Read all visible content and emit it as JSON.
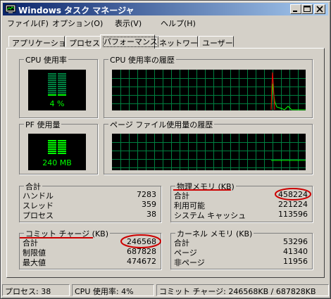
{
  "window": {
    "title": "Windows タスク マネージャ"
  },
  "menu": [
    "ファイル(F)",
    "オプション(O)",
    "表示(V)",
    "ヘルプ(H)"
  ],
  "tabs": [
    "アプリケーション",
    "プロセス",
    "パフォーマンス",
    "ネットワーク",
    "ユーザー"
  ],
  "active_tab": "パフォーマンス",
  "cpu_usage": {
    "label": "CPU 使用率",
    "value_text": "4 %",
    "level": 0.04
  },
  "cpu_history": {
    "label": "CPU 使用率の履歴"
  },
  "pf_usage": {
    "label": "PF 使用量",
    "value_text": "240 MB"
  },
  "pf_history": {
    "label": "ページ ファイル使用量の履歴"
  },
  "totals": {
    "label": "合計",
    "rows": [
      {
        "k": "ハンドル",
        "v": "7283"
      },
      {
        "k": "スレッド",
        "v": "359"
      },
      {
        "k": "プロセス",
        "v": "38"
      }
    ]
  },
  "physical_memory": {
    "label": "物理メモリ (KB)",
    "rows": [
      {
        "k": "合計",
        "v": "458224"
      },
      {
        "k": "利用可能",
        "v": "221224"
      },
      {
        "k": "システム キャッシュ",
        "v": "113596"
      }
    ]
  },
  "commit_charge": {
    "label": "コミット チャージ (KB)",
    "rows": [
      {
        "k": "合計",
        "v": "246568"
      },
      {
        "k": "制限値",
        "v": "687828"
      },
      {
        "k": "最大値",
        "v": "474672"
      }
    ]
  },
  "kernel_memory": {
    "label": "カーネル メモリ (KB)",
    "rows": [
      {
        "k": "合計",
        "v": "53296"
      },
      {
        "k": "ページ",
        "v": "41340"
      },
      {
        "k": "非ページ",
        "v": "11956"
      }
    ]
  },
  "status": {
    "processes": "プロセス: 38",
    "cpu": "CPU 使用率: 4%",
    "commit": "コミット チャージ: 246568KB / 687828KB"
  },
  "colors": {
    "graph_grid": "#008040",
    "graph_line": "#00ff00",
    "kernel_line": "#ff0000",
    "annotation": "#cc0000"
  },
  "icons": {
    "app": "task-manager-icon",
    "minimize": "minimize-icon",
    "maximize": "maximize-icon",
    "close": "close-icon"
  }
}
